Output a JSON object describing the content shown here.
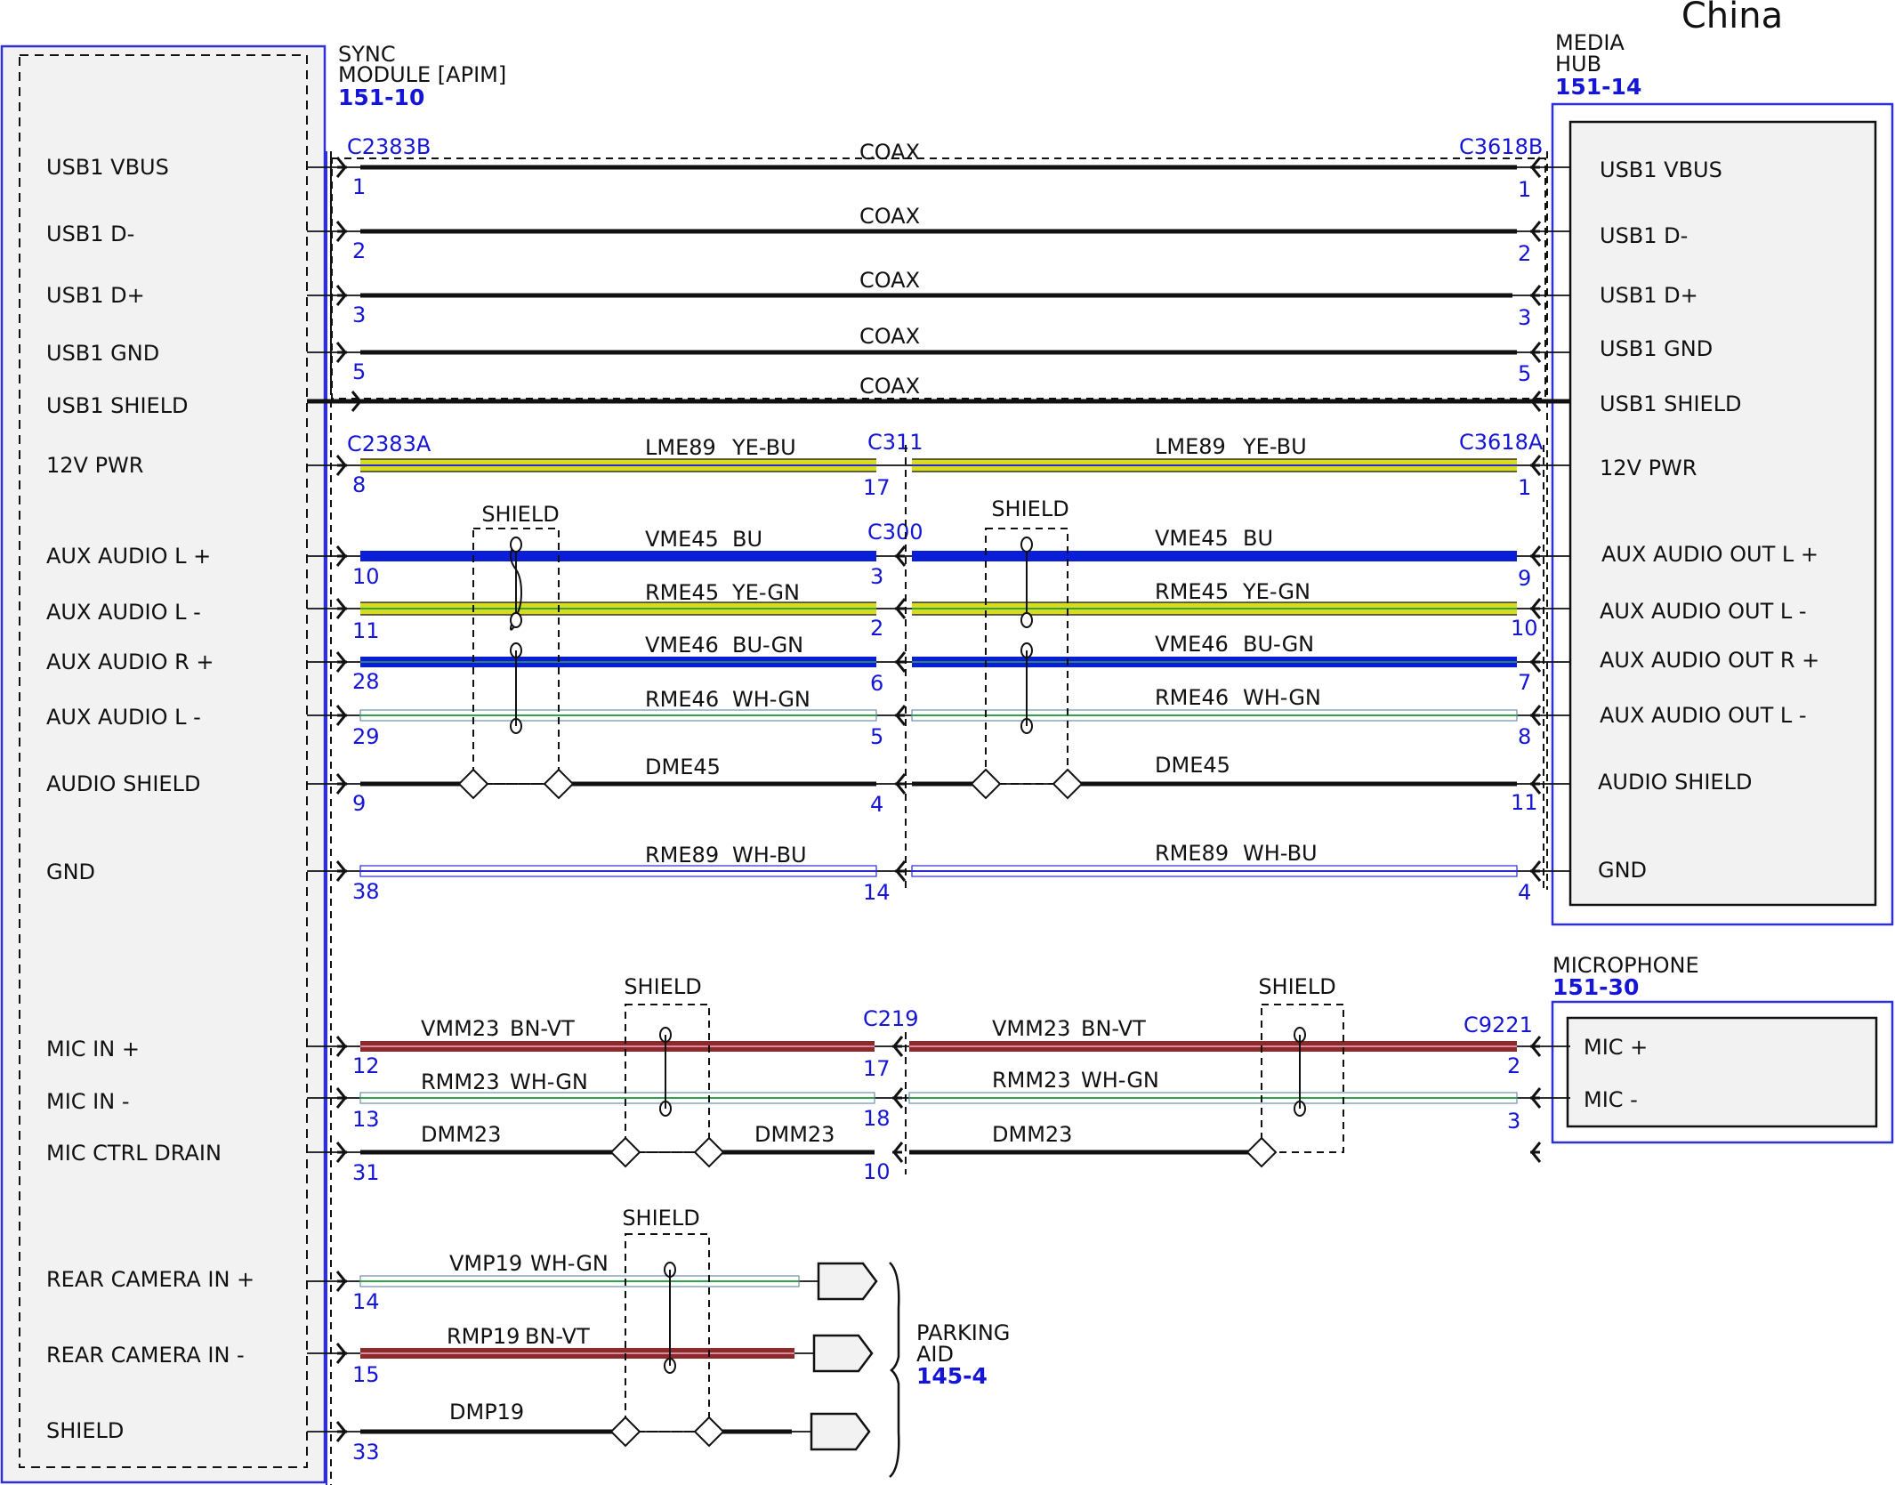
{
  "title": "China",
  "colors": {
    "blue_frame": "#2f2fd6",
    "module_fill": "#f2f2f2",
    "wire_black": "#111111",
    "wire_yellow": "#d9dc1e",
    "wire_blue": "#0a1ed8",
    "wire_green": "#2fa24a",
    "wire_white": "#ffffff",
    "wire_brown": "#8b2a2a",
    "wire_violet": "#c2607a",
    "pin_blue": "#1515d6"
  },
  "sync_module": {
    "name_line1": "SYNC",
    "name_line2": "MODULE [APIM]",
    "ref": "151-10",
    "pins": [
      {
        "label": "USB1 VBUS"
      },
      {
        "label": "USB1 D-"
      },
      {
        "label": "USB1 D+"
      },
      {
        "label": "USB1 GND"
      },
      {
        "label": "USB1 SHIELD"
      },
      {
        "label": "12V PWR"
      },
      {
        "label": "AUX AUDIO L +"
      },
      {
        "label": "AUX AUDIO L -"
      },
      {
        "label": "AUX AUDIO R +"
      },
      {
        "label": "AUX AUDIO L -"
      },
      {
        "label": "AUDIO SHIELD"
      },
      {
        "label": "GND"
      },
      {
        "label": "MIC IN +"
      },
      {
        "label": "MIC IN -"
      },
      {
        "label": "MIC CTRL DRAIN"
      },
      {
        "label": "REAR CAMERA IN +"
      },
      {
        "label": "REAR CAMERA IN -"
      },
      {
        "label": "SHIELD"
      }
    ]
  },
  "media_hub": {
    "name_line1": "MEDIA",
    "name_line2": "HUB",
    "ref": "151-14",
    "pins": [
      {
        "label": "USB1 VBUS"
      },
      {
        "label": "USB1 D-"
      },
      {
        "label": "USB1 D+"
      },
      {
        "label": "USB1 GND"
      },
      {
        "label": "USB1 SHIELD"
      },
      {
        "label": "12V PWR"
      },
      {
        "label": "AUX AUDIO OUT L +"
      },
      {
        "label": "AUX AUDIO OUT L -"
      },
      {
        "label": "AUX AUDIO OUT R +"
      },
      {
        "label": "AUX AUDIO OUT L -"
      },
      {
        "label": "AUDIO SHIELD"
      },
      {
        "label": "GND"
      }
    ]
  },
  "microphone": {
    "name": "MICROPHONE",
    "ref": "151-30",
    "pins": [
      {
        "label": "MIC +"
      },
      {
        "label": "MIC -"
      }
    ]
  },
  "parking_aid": {
    "name_line1": "PARKING",
    "name_line2": "AID",
    "ref": "145-4"
  },
  "connectors": {
    "c2383b": "C2383B",
    "c3618b": "C3618B",
    "c2383a": "C2383A",
    "c311": "C311",
    "c3618a": "C3618A",
    "c300": "C300",
    "c219": "C219",
    "c9221": "C9221"
  },
  "shield_label": "SHIELD",
  "usb_wires": [
    {
      "cable": "COAX",
      "pin_left": "1",
      "pin_right": "1"
    },
    {
      "cable": "COAX",
      "pin_left": "2",
      "pin_right": "2"
    },
    {
      "cable": "COAX",
      "pin_left": "3",
      "pin_right": "3"
    },
    {
      "cable": "COAX",
      "pin_left": "5",
      "pin_right": "5"
    },
    {
      "cable": "COAX"
    }
  ],
  "wires": [
    {
      "circuit_a": "LME89",
      "color_a": "YE-BU",
      "circuit_b": "LME89",
      "color_b": "YE-BU",
      "pin_left": "8",
      "pin_mid": "17",
      "pin_right": "1"
    },
    {
      "circuit_a": "VME45",
      "color_a": "BU",
      "circuit_b": "VME45",
      "color_b": "BU",
      "pin_left": "10",
      "pin_mid": "3",
      "pin_right": "9"
    },
    {
      "circuit_a": "RME45",
      "color_a": "YE-GN",
      "circuit_b": "RME45",
      "color_b": "YE-GN",
      "pin_left": "11",
      "pin_mid": "2",
      "pin_right": "10"
    },
    {
      "circuit_a": "VME46",
      "color_a": "BU-GN",
      "circuit_b": "VME46",
      "color_b": "BU-GN",
      "pin_left": "28",
      "pin_mid": "6",
      "pin_right": "7"
    },
    {
      "circuit_a": "RME46",
      "color_a": "WH-GN",
      "circuit_b": "RME46",
      "color_b": "WH-GN",
      "pin_left": "29",
      "pin_mid": "5",
      "pin_right": "8"
    },
    {
      "circuit_a": "DME45",
      "circuit_b": "DME45",
      "pin_left": "9",
      "pin_mid": "4",
      "pin_right": "11"
    },
    {
      "circuit_a": "RME89",
      "color_a": "WH-BU",
      "circuit_b": "RME89",
      "color_b": "WH-BU",
      "pin_left": "38",
      "pin_mid": "14",
      "pin_right": "4"
    },
    {
      "circuit_a": "VMM23",
      "color_a": "BN-VT",
      "circuit_b": "VMM23",
      "color_b": "BN-VT",
      "pin_left": "12",
      "pin_mid": "17",
      "pin_right": "2"
    },
    {
      "circuit_a": "RMM23",
      "color_a": "WH-GN",
      "circuit_b": "RMM23",
      "color_b": "WH-GN",
      "pin_left": "13",
      "pin_mid": "18",
      "pin_right": "3"
    },
    {
      "circuit_a": "DMM23",
      "circuit_a2": "DMM23",
      "circuit_b": "DMM23",
      "pin_left": "31",
      "pin_mid": "10"
    },
    {
      "circuit_a": "VMP19",
      "color_a": "WH-GN",
      "pin_left": "14"
    },
    {
      "circuit_a": "RMP19",
      "color_a": "BN-VT",
      "pin_left": "15"
    },
    {
      "circuit_a": "DMP19",
      "pin_left": "33"
    }
  ]
}
